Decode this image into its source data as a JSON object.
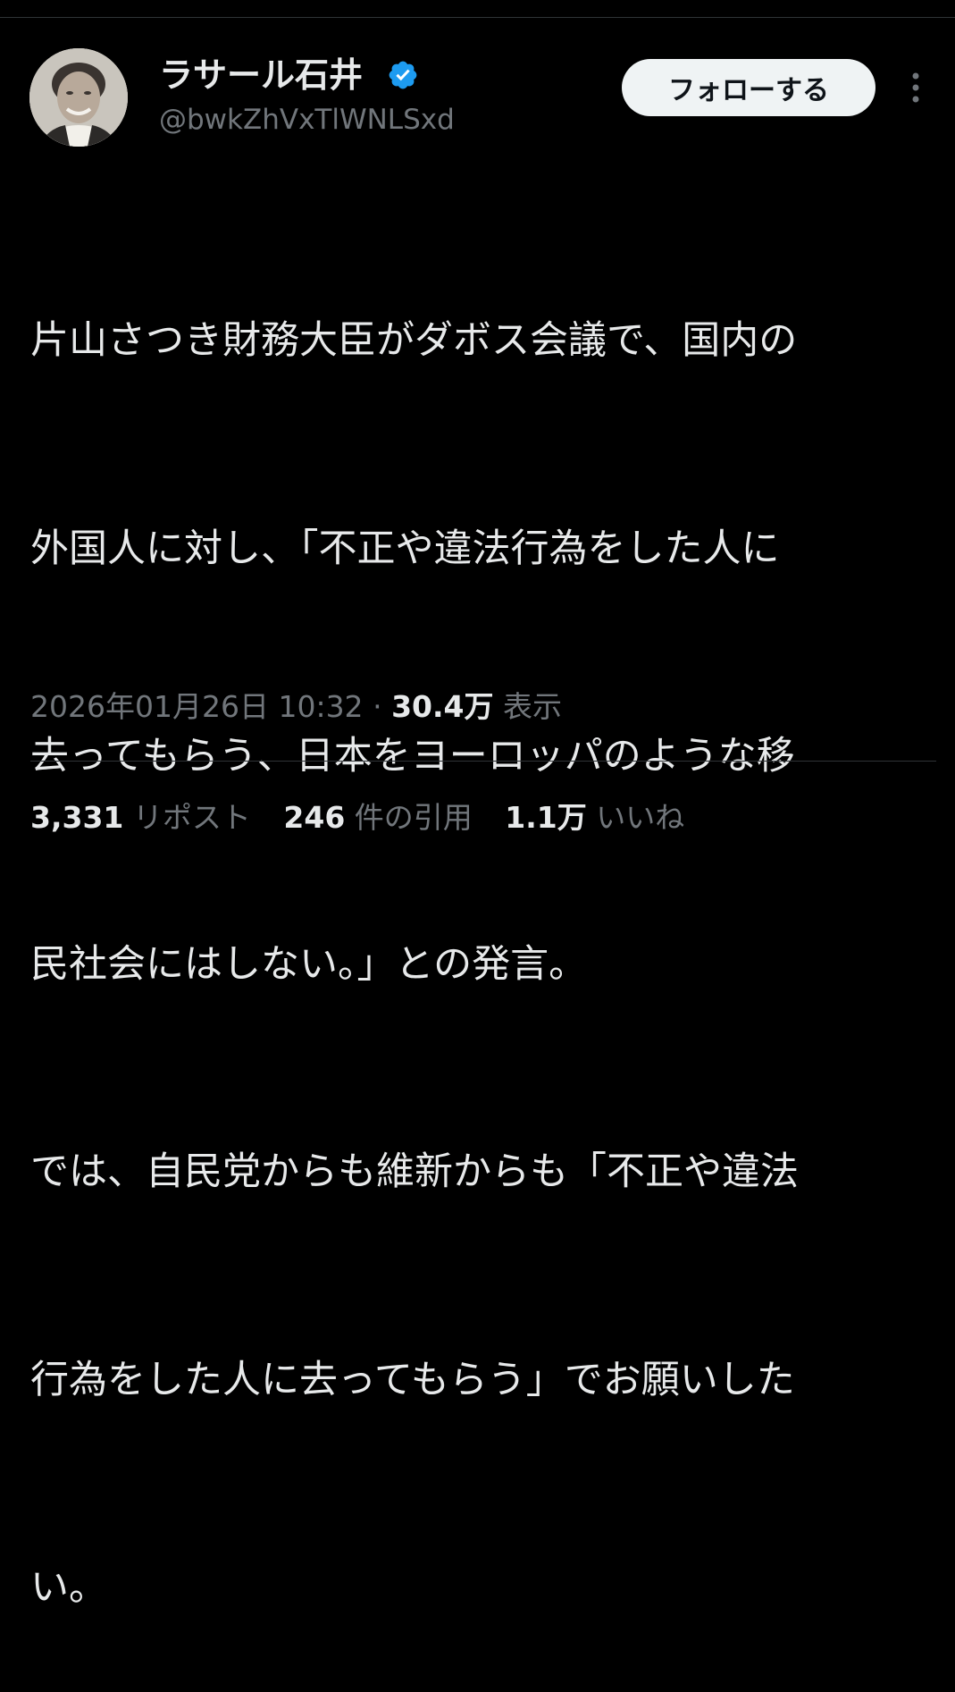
{
  "tweet": {
    "author": {
      "display_name": "ラサール石井",
      "handle": "@bwkZhVxTlWNLSxd",
      "verified": true,
      "avatar_icon": "avatar-photo",
      "verified_icon": "verified-badge-icon"
    },
    "follow_label": "フォローする",
    "more_icon": "more-options-icon",
    "text_lines": [
      "片山さつき財務大臣がダボス会議で、国内の",
      "外国人に対し、「不正や違法行為をした人に",
      "去ってもらう、日本をヨーロッパのような移",
      "民社会にはしない。」との発言。",
      "では、自民党からも維新からも「不正や違法",
      "行為をした人に去ってもらう」でお願いした",
      "い。"
    ],
    "timestamp": "2026年01月26日 10:32",
    "separator": "·",
    "views_count": "30.4万",
    "views_label": "表示",
    "stats": {
      "reposts_count": "3,331",
      "reposts_label": "リポスト",
      "quotes_count": "246",
      "quotes_label": "件の引用",
      "likes_count": "1.1万",
      "likes_label": "いいね"
    }
  },
  "colors": {
    "background": "#000000",
    "primary_text": "#e7e9ea",
    "secondary_text": "#71767b",
    "divider": "#2f3336",
    "verified_blue": "#1d9bf0",
    "follow_button_bg": "#eff3f4"
  }
}
